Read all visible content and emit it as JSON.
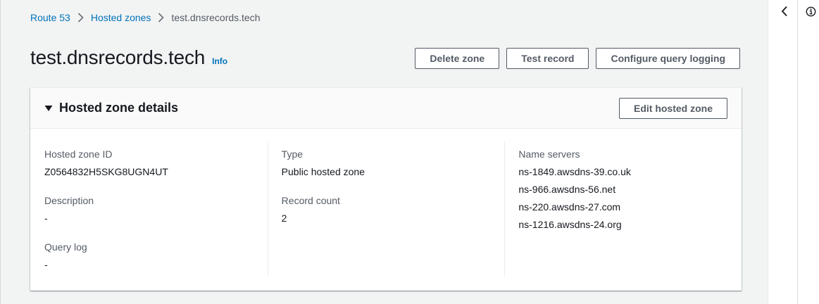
{
  "breadcrumb": {
    "items": [
      "Route 53",
      "Hosted zones"
    ],
    "current": "test.dnsrecords.tech"
  },
  "header": {
    "title": "test.dnsrecords.tech",
    "info_label": "Info",
    "actions": {
      "delete": "Delete zone",
      "test": "Test record",
      "logging": "Configure query logging"
    }
  },
  "details": {
    "title": "Hosted zone details",
    "edit_label": "Edit hosted zone",
    "hosted_zone_id": {
      "label": "Hosted zone ID",
      "value": "Z0564832H5SKG8UGN4UT"
    },
    "description": {
      "label": "Description",
      "value": "-"
    },
    "query_log": {
      "label": "Query log",
      "value": "-"
    },
    "type": {
      "label": "Type",
      "value": "Public hosted zone"
    },
    "record_count": {
      "label": "Record count",
      "value": "2"
    },
    "name_servers": {
      "label": "Name servers",
      "values": [
        "ns-1849.awsdns-39.co.uk",
        "ns-966.awsdns-56.net",
        "ns-220.awsdns-27.com",
        "ns-1216.awsdns-24.org"
      ]
    }
  },
  "icons": {
    "collapse": "chevron-left-icon",
    "info": "info-circle-icon"
  },
  "colors": {
    "link": "#0073bb",
    "text": "#16191f",
    "secondary": "#545b64",
    "background": "#f2f3f3"
  }
}
